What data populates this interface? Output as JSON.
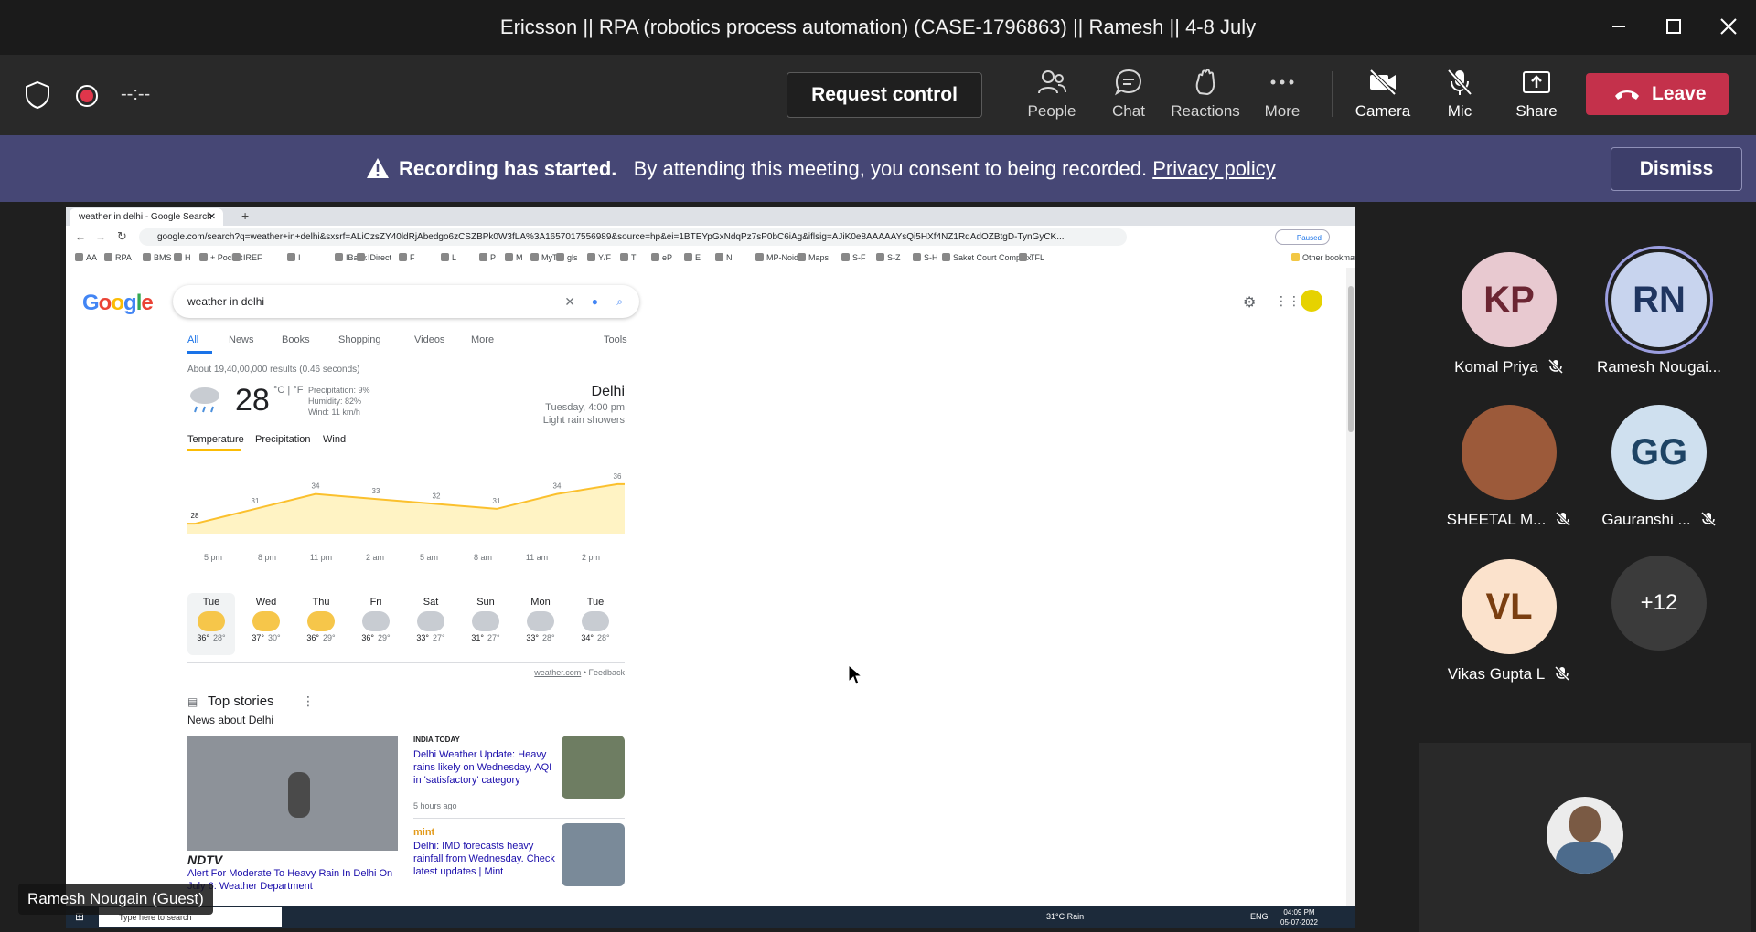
{
  "window": {
    "title": "Ericsson || RPA (robotics process automation) (CASE-1796863) || Ramesh || 4-8 July"
  },
  "toolbar": {
    "timer": "--:--",
    "request_control": "Request control",
    "items": [
      "People",
      "Chat",
      "Reactions",
      "More",
      "Camera",
      "Mic",
      "Share"
    ],
    "leave": "Leave"
  },
  "banner": {
    "bold": "Recording has started.",
    "text": "By attending this meeting, you consent to being recorded.",
    "link": "Privacy policy",
    "dismiss": "Dismiss"
  },
  "shared_screen": {
    "tab_title": "weather in delhi - Google Search",
    "url": "google.com/search?q=weather+in+delhi&sxsrf=ALiCzsZY40ldRjAbedgo6zCSZBPk0W3fLA%3A1657017556989&source=hp&ei=1BTEYpGxNdqPz7sP0bC6iAg&iflsig=AJiK0e8AAAAAYsQi5HXf4NZ1RqAdOZBtgD-TynGyCK...",
    "profile": "Paused",
    "bookmarks": [
      "AA",
      "RPA",
      "BMS",
      "H",
      "+ Pocket",
      "IREF",
      "I",
      "IBank",
      "IDirect",
      "F",
      "L",
      "P",
      "M",
      "MyTV",
      "gls",
      "Y/F",
      "T",
      "eP",
      "E",
      "N",
      "MP-Noida",
      "Maps",
      "S-F",
      "S-Z",
      "S-H",
      "Saket Court Complex",
      "TFL",
      "Other bookmarks"
    ],
    "search_query": "weather in delhi",
    "tabs": [
      "All",
      "News",
      "Books",
      "Shopping",
      "Videos",
      "More",
      "Tools"
    ],
    "results_count": "About 19,40,00,000 results (0.46 seconds)",
    "weather": {
      "temp": "28",
      "units": "°C | °F",
      "precipitation": "Precipitation: 9%",
      "humidity": "Humidity: 82%",
      "wind": "Wind: 11 km/h",
      "location": "Delhi",
      "time": "Tuesday, 4:00 pm",
      "condition": "Light rain showers",
      "tabs": [
        "Temperature",
        "Precipitation",
        "Wind"
      ],
      "graph_values": [
        "28",
        "31",
        "34",
        "33",
        "32",
        "31",
        "34",
        "36"
      ],
      "graph_times": [
        "5 pm",
        "8 pm",
        "11 pm",
        "2 am",
        "5 am",
        "8 am",
        "11 am",
        "2 pm"
      ],
      "days": [
        {
          "day": "Tue",
          "hi": "36°",
          "lo": "28°"
        },
        {
          "day": "Wed",
          "hi": "37°",
          "lo": "30°"
        },
        {
          "day": "Thu",
          "hi": "36°",
          "lo": "29°"
        },
        {
          "day": "Fri",
          "hi": "36°",
          "lo": "29°"
        },
        {
          "day": "Sat",
          "hi": "33°",
          "lo": "27°"
        },
        {
          "day": "Sun",
          "hi": "31°",
          "lo": "27°"
        },
        {
          "day": "Mon",
          "hi": "33°",
          "lo": "28°"
        },
        {
          "day": "Tue",
          "hi": "34°",
          "lo": "28°"
        }
      ],
      "source": "weather.com",
      "feedback": "Feedback"
    },
    "top_stories": {
      "title": "Top stories",
      "subtitle": "News about Delhi",
      "story1_source": "NDTV",
      "story1_title": "Alert For Moderate To Heavy Rain In Delhi On July 6: Weather Department",
      "story2_source": "INDIA TODAY",
      "story2_title": "Delhi Weather Update: Heavy rains likely on Wednesday, AQI in 'satisfactory' category",
      "story2_time": "5 hours ago",
      "story3_source": "mint",
      "story3_title": "Delhi: IMD forecasts heavy rainfall from Wednesday. Check latest updates | Mint"
    },
    "taskbar": {
      "search_placeholder": "Type here to search",
      "weather": "31°C Rain",
      "lang": "ENG",
      "time": "04:09 PM",
      "date": "05-07-2022"
    }
  },
  "presenter_label": "Ramesh Nougain (Guest)",
  "participants": [
    {
      "initials": "KP",
      "name": "Komal Priya",
      "bg": "#e8c9d0",
      "fg": "#6b2532",
      "muted": true
    },
    {
      "initials": "RN",
      "name": "Ramesh Nougai...",
      "bg": "#c8d4ee",
      "fg": "#1f3560",
      "muted": false
    },
    {
      "initials": "",
      "name": "SHEETAL M...",
      "bg": "#9c5a3a",
      "fg": "#fff",
      "muted": true
    },
    {
      "initials": "GG",
      "name": "Gauranshi ...",
      "bg": "#cfe0ef",
      "fg": "#1e4465",
      "muted": true
    },
    {
      "initials": "VL",
      "name": "Vikas Gupta L",
      "bg": "#fbe2cc",
      "fg": "#7a3e10",
      "muted": true
    },
    {
      "initials": "+12",
      "name": "",
      "bg": "#3b3b3b",
      "fg": "#fff",
      "muted": false
    }
  ]
}
